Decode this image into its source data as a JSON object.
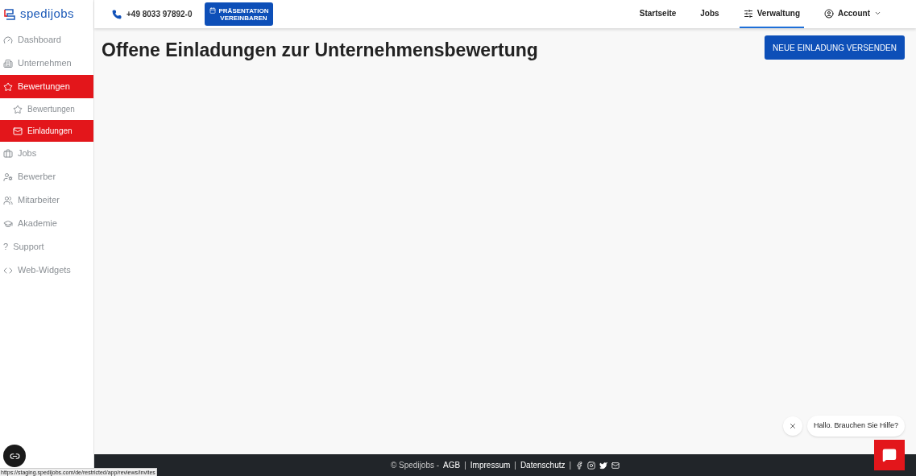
{
  "logo": {
    "text": "spedijobs"
  },
  "topbar": {
    "phone": "+49 8033 97892-0",
    "presentation_button": "PRÄSENTATION VEREINBAREN",
    "nav": [
      {
        "label": "Startseite",
        "kind": "plain",
        "selected": false
      },
      {
        "label": "Jobs",
        "kind": "plain",
        "selected": false
      },
      {
        "label": "Verwaltung",
        "kind": "settings",
        "selected": true
      },
      {
        "label": "Account",
        "kind": "account",
        "selected": false
      }
    ]
  },
  "sidebar": {
    "items": [
      {
        "label": "Dashboard",
        "kind": "dashboard",
        "selected": false
      },
      {
        "label": "Unternehmen",
        "kind": "building",
        "selected": false
      },
      {
        "label": "Bewertungen",
        "kind": "star",
        "selected": true,
        "children": [
          {
            "label": "Bewertungen",
            "kind": "star",
            "selected": false
          },
          {
            "label": "Einladungen",
            "kind": "mail",
            "selected": true
          }
        ]
      },
      {
        "label": "Jobs",
        "kind": "briefcase",
        "selected": false
      },
      {
        "label": "Bewerber",
        "kind": "user",
        "selected": false
      },
      {
        "label": "Mitarbeiter",
        "kind": "users",
        "selected": false
      },
      {
        "label": "Akademie",
        "kind": "academy",
        "selected": false
      },
      {
        "label": "Support",
        "kind": "help",
        "symbol": "?",
        "selected": false
      },
      {
        "label": "Web-Widgets",
        "kind": "code",
        "selected": false
      }
    ]
  },
  "page": {
    "title": "Offene Einladungen zur Unternehmensbewertung",
    "action_button": "NEUE EINLADUNG VERSENDEN"
  },
  "footer": {
    "copyright": "© Spedijobs -",
    "links": [
      {
        "label": "AGB",
        "separator": "|"
      },
      {
        "label": "Impressum",
        "separator": "|"
      },
      {
        "label": "Datenschutz",
        "separator": "|"
      }
    ]
  },
  "chat": {
    "message": "Hallo. Brauchen Sie Hilfe?"
  },
  "status_url": "https://staging.spedijobs.com/de/restricted/app/reviews/invites"
}
